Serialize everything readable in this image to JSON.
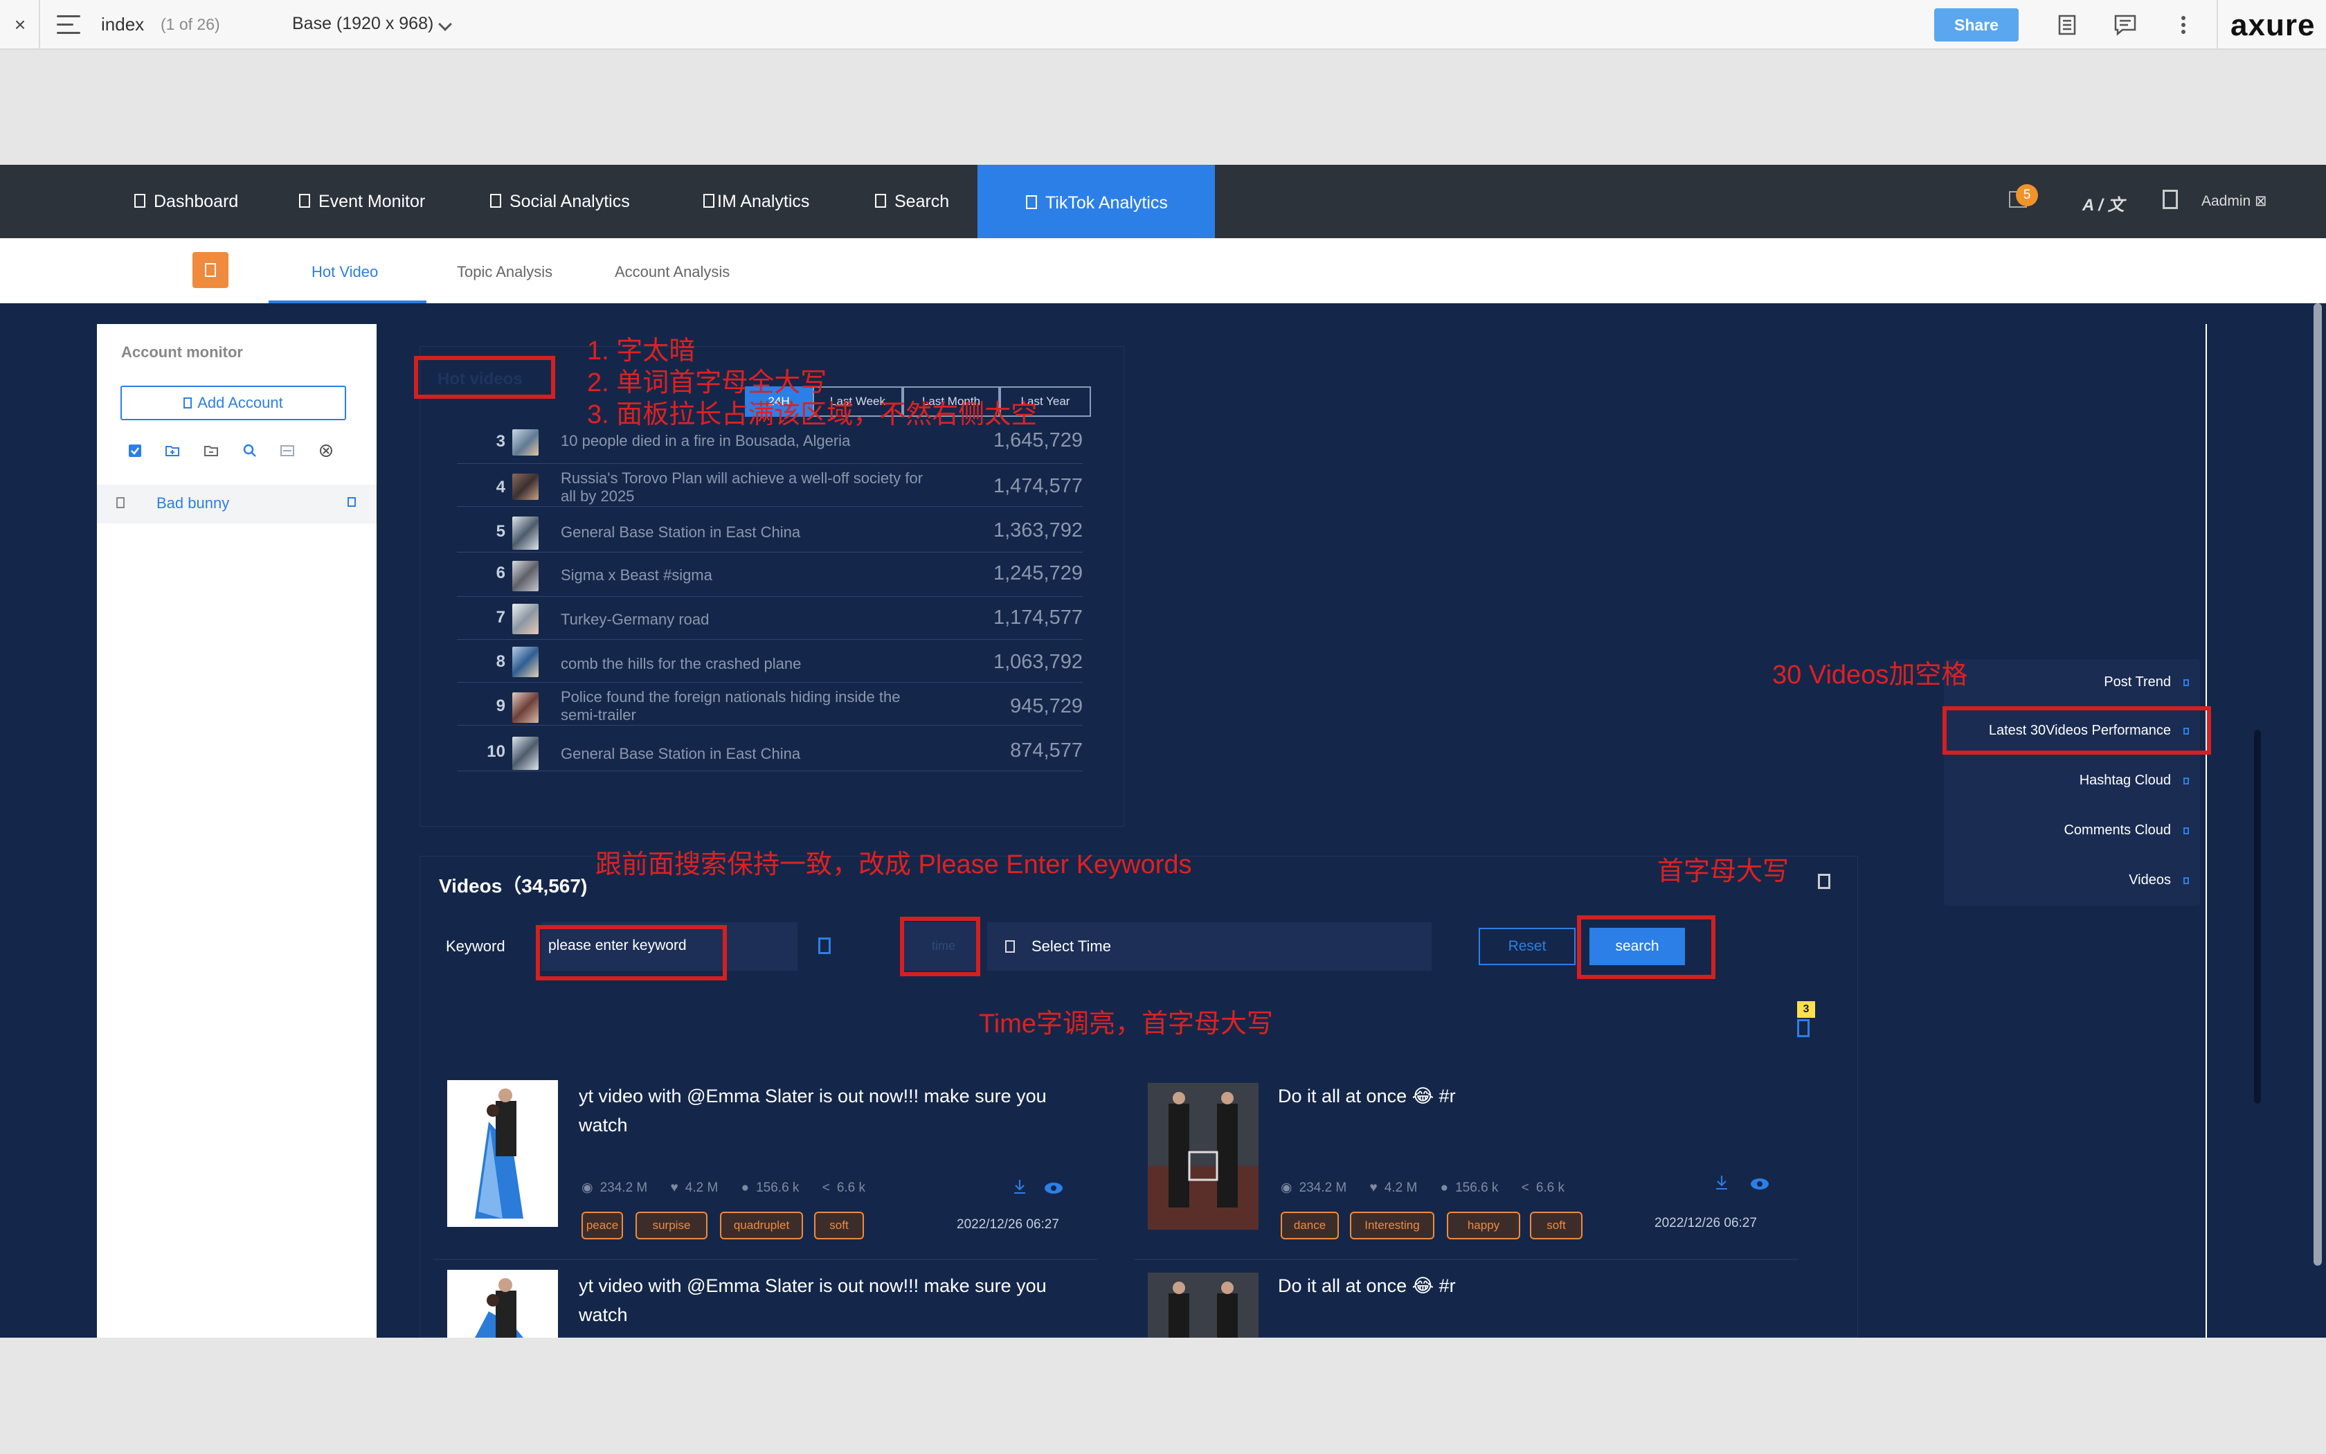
{
  "toolbar": {
    "close": "×",
    "page_name": "index",
    "page_count": "(1 of 26)",
    "base": "Base (1920 x 968)",
    "share": "Share",
    "logo": "axure"
  },
  "nav": {
    "items": [
      "Dashboard",
      "Event Monitor",
      "Social Analytics",
      "IM Analytics",
      "Search",
      "TikTok Analytics"
    ],
    "active": "TikTok Analytics",
    "notification_count": "5",
    "lang": "A / 文",
    "user": "Aadmin ⊠"
  },
  "subtabs": {
    "items": [
      "Hot Video",
      "Topic Analysis",
      "Account Analysis"
    ],
    "active": "Hot Video"
  },
  "sidebar": {
    "title": "Account monitor",
    "add_button": "Add Account",
    "accounts": [
      "Bad bunny"
    ]
  },
  "hot": {
    "title": "Hot videos",
    "filters": [
      "24H",
      "Last Week",
      "Last Month",
      "Last Year"
    ],
    "active_filter": "24H",
    "rows": [
      {
        "rank": "3",
        "title": "10 people died in a fire in Bousada, Algeria",
        "views": "1,645,729"
      },
      {
        "rank": "4",
        "title": "Russia's Torovo Plan will achieve a well-off society for all by 2025",
        "views": "1,474,577"
      },
      {
        "rank": "5",
        "title": "General Base Station in East China",
        "views": "1,363,792"
      },
      {
        "rank": "6",
        "title": "Sigma x Beast #sigma",
        "views": "1,245,729"
      },
      {
        "rank": "7",
        "title": " Turkey-Germany road",
        "views": "1,174,577"
      },
      {
        "rank": "8",
        "title": "comb the hills for the crashed plane",
        "views": "1,063,792"
      },
      {
        "rank": "9",
        "title": "Police found the foreign nationals hiding inside the semi-trailer",
        "views": "945,729"
      },
      {
        "rank": "10",
        "title": "General Base Station in East China",
        "views": "874,577"
      }
    ]
  },
  "float_menu": {
    "items": [
      "Post Trend",
      "Latest 30Videos Performance",
      "Hashtag Cloud",
      "Comments Cloud",
      "Videos"
    ]
  },
  "videos": {
    "title": "Videos（34,567)",
    "keyword_label": "Keyword",
    "keyword_value": "please enter keyword",
    "time_label": "time",
    "date_placeholder": "Select Time",
    "reset": "Reset",
    "search": "search",
    "result_badge": "3",
    "cards": [
      {
        "title": "yt video with @Emma Slater is out now!!! make sure you watch",
        "views": "234.2 M",
        "likes": "4.2 M",
        "comments": "156.6 k",
        "shares": "6.6 k",
        "tags": [
          "peace",
          "surpise",
          "quadruplet",
          "soft"
        ],
        "date": "2022/12/26 06:27"
      },
      {
        "title": "Do it all at once 😂 #r",
        "views": "234.2 M",
        "likes": "4.2 M",
        "comments": "156.6 k",
        "shares": "6.6 k",
        "tags": [
          "dance",
          "Interesting",
          "happy",
          "soft"
        ],
        "date": "2022/12/26 06:27"
      },
      {
        "title": "yt video with @Emma Slater is out now!!! make sure you watch"
      },
      {
        "title": "Do it all at once 😂 #r"
      }
    ]
  },
  "annotations": {
    "a1": "1. 字太暗",
    "a2": "2. 单词首字母全大写",
    "a3": "3. 面板拉长占满该区域，不然右侧太空",
    "a4": "30 Videos加空格",
    "a5": "跟前面搜索保持一致，改成 Please Enter Keywords",
    "a6": "首字母大写",
    "a7": "Time字调亮，首字母大写"
  },
  "colors": {
    "accent": "#2c7fe6",
    "nav_bg": "#2d333b",
    "dark_bg": "#14274a",
    "tag_orange": "#f08a3c",
    "annotation_red": "#e02020"
  }
}
